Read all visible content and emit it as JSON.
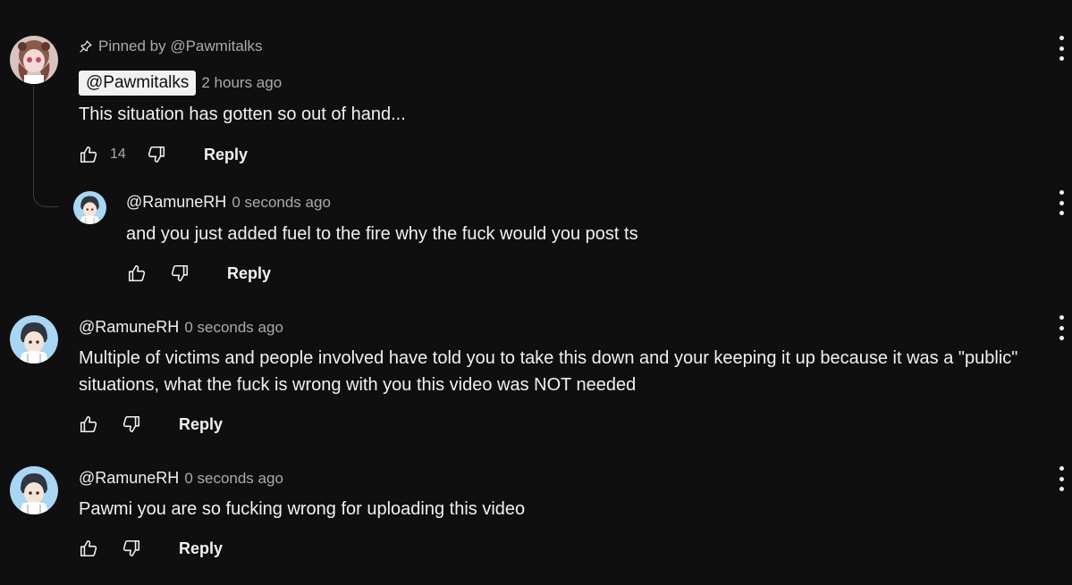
{
  "pinned_comment": {
    "pinned_label": "Pinned by @Pawmitalks",
    "author": "@Pawmitalks",
    "time": "2 hours ago",
    "text": "This situation has gotten so out of hand...",
    "likes": "14",
    "reply_label": "Reply"
  },
  "reply": {
    "author": "@RamuneRH",
    "time": "0 seconds ago",
    "text": "and you just added fuel to the fire why the fuck would you post ts",
    "reply_label": "Reply"
  },
  "comments": [
    {
      "author": "@RamuneRH",
      "time": "0 seconds ago",
      "text": "Multiple of victims and people involved have told you to take this down and your keeping it up because it was a \"public\" situations, what the fuck is wrong with you this video was NOT needed",
      "reply_label": "Reply"
    },
    {
      "author": "@RamuneRH",
      "time": "0 seconds ago",
      "text": "Pawmi you are so fucking wrong for uploading this video",
      "reply_label": "Reply"
    }
  ],
  "icons": {
    "pin": "pin-icon",
    "like": "thumbs-up-icon",
    "dislike": "thumbs-down-icon",
    "more": "more-vertical-icon"
  },
  "colors": {
    "background": "#0f0f0f",
    "text": "#f1f1f1",
    "secondary_text": "#aaaaaa",
    "author_chip_bg": "#f1f1f1"
  }
}
